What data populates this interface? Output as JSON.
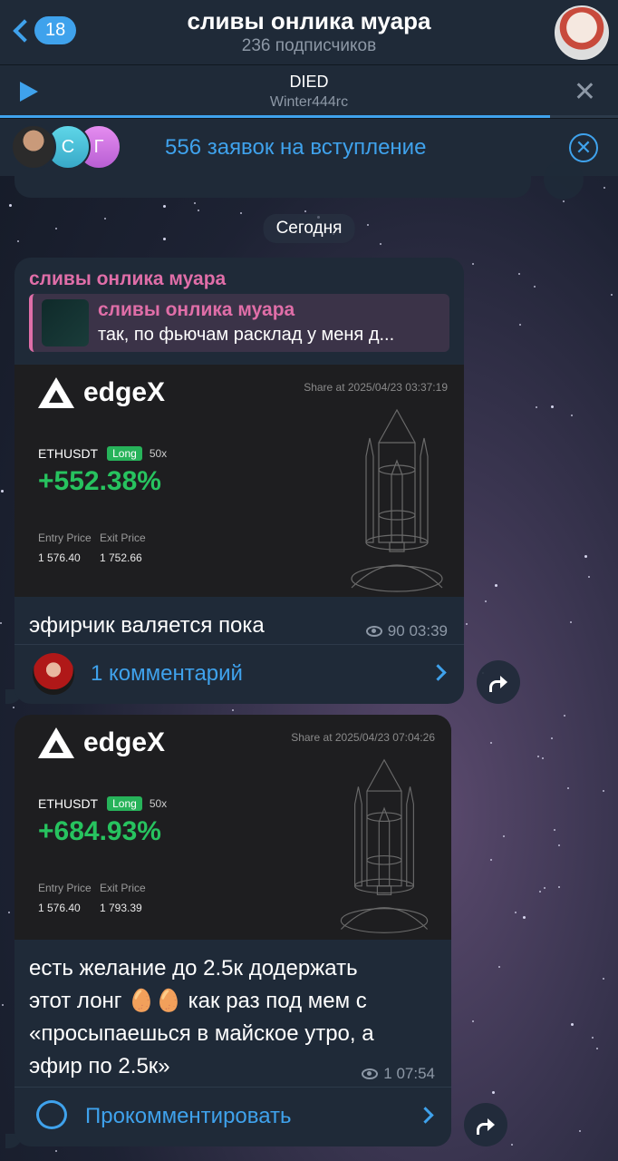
{
  "header": {
    "back_count": "18",
    "title": "сливы онлика муара",
    "subtitle": "236 подписчиков"
  },
  "player": {
    "track": "DIED",
    "artist": "Winter444rc",
    "progress": 0.89
  },
  "join_bar": {
    "avatar_letters": [
      "С",
      "Г"
    ],
    "text": "556 заявок на вступление"
  },
  "date_separator": "Сегодня",
  "messages": [
    {
      "sender": "сливы онлика муара",
      "reply": {
        "name": "сливы онлика муара",
        "text": "так, по фьючам расклад у меня д..."
      },
      "card": {
        "brand": "edgeX",
        "share_at": "Share at 2025/04/23 03:37:19",
        "pair": "ETHUSDT",
        "side": "Long",
        "leverage": "50x",
        "pnl": "+552.38%",
        "entry_label": "Entry Price",
        "exit_label": "Exit Price",
        "entry_price": "1 576.40",
        "exit_price": "1 752.66"
      },
      "text": "эфирчик валяется пока",
      "views": "90",
      "time": "03:39",
      "comments_label": "1 комментарий"
    },
    {
      "card": {
        "brand": "edgeX",
        "share_at": "Share at 2025/04/23 07:04:26",
        "pair": "ETHUSDT",
        "side": "Long",
        "leverage": "50x",
        "pnl": "+684.93%",
        "entry_label": "Entry Price",
        "exit_label": "Exit Price",
        "entry_price": "1 576.40",
        "exit_price": "1 793.39"
      },
      "text_lines": [
        "есть желание до 2.5к додержать",
        "этот лонг 🥚🥚 как раз под мем с",
        "«просыпаешься в майское утро, а",
        "эфир по 2.5к»"
      ],
      "views": "1",
      "time": "07:54",
      "comments_label": "Прокомментировать"
    }
  ],
  "colors": {
    "accent": "#3fa2ec",
    "sender": "#e06ea8",
    "bubble": "#1f2a38",
    "profit": "#27c35f"
  }
}
